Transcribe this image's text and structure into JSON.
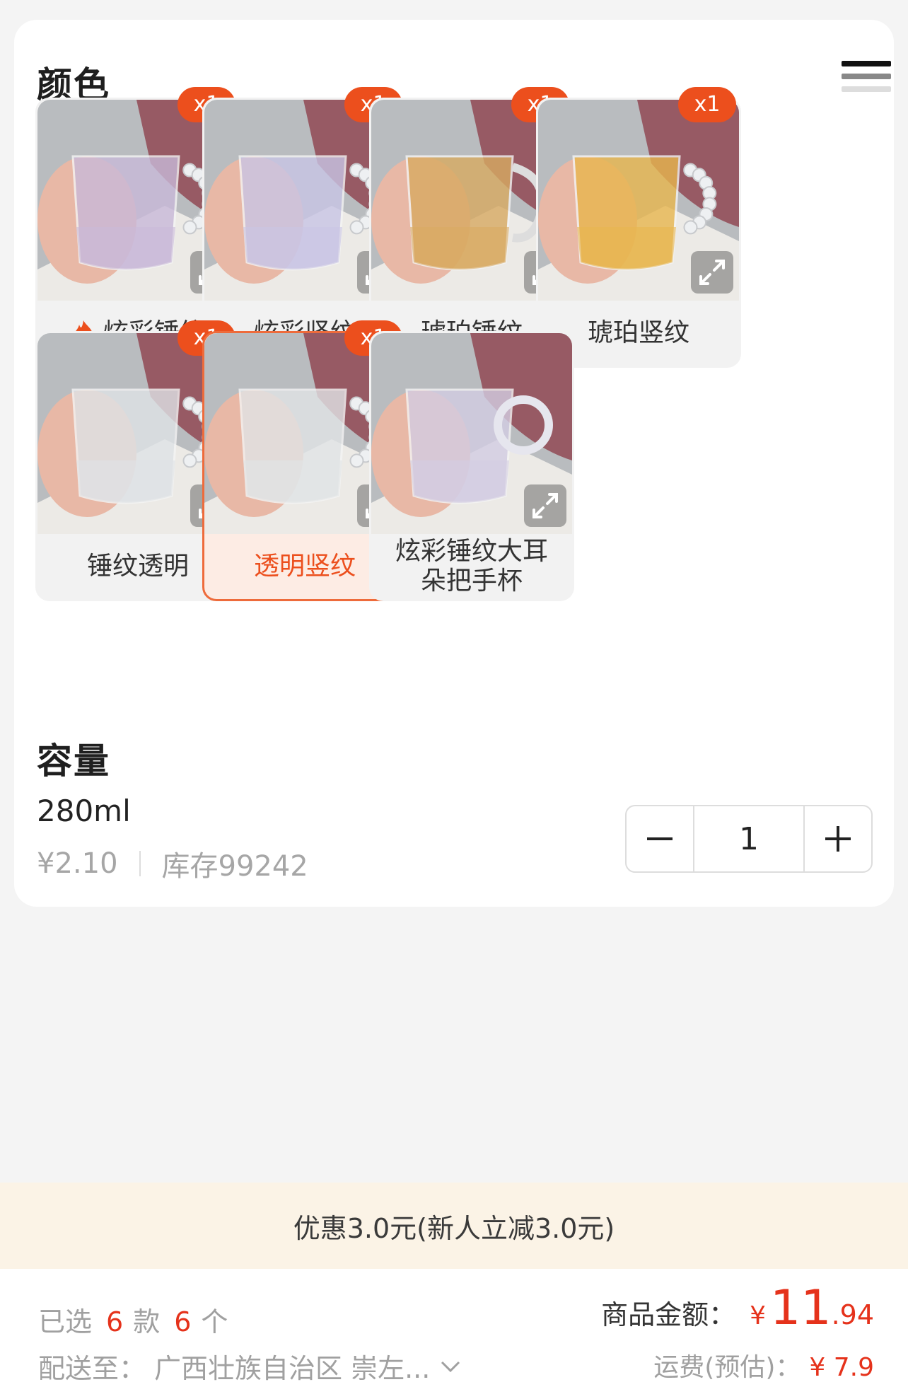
{
  "color_section": {
    "title": "颜色",
    "variants": [
      {
        "label": "炫彩锤纹",
        "badge": "x1",
        "hot": true,
        "selected": false,
        "tint": "#c9b9d9",
        "handle": "beads"
      },
      {
        "label": "炫彩竖纹",
        "badge": "x1",
        "hot": false,
        "selected": false,
        "tint": "#c9c5e5",
        "handle": "beads"
      },
      {
        "label": "琥珀锤纹",
        "badge": "x1",
        "hot": false,
        "selected": false,
        "tint": "#d8aa62",
        "handle": "plain"
      },
      {
        "label": "琥珀竖纹",
        "badge": "x1",
        "hot": false,
        "selected": false,
        "tint": "#e8b64e",
        "handle": "beads"
      },
      {
        "label": "锤纹透明",
        "badge": "x1",
        "hot": false,
        "selected": false,
        "tint": "#dfe3e6",
        "handle": "beads"
      },
      {
        "label": "透明竖纹",
        "badge": "x1",
        "hot": false,
        "selected": true,
        "tint": "#e1e4e6",
        "handle": "beads"
      },
      {
        "label": "炫彩锤纹大耳朵把手杯",
        "badge": "",
        "hot": false,
        "selected": false,
        "tint": "#d3cde3",
        "handle": "ring"
      }
    ]
  },
  "capacity_section": {
    "title": "容量",
    "option": {
      "name": "280ml",
      "price": "¥2.10",
      "stock": "库存99242"
    },
    "quantity": "1"
  },
  "promo": {
    "text": "优惠3.0元(新人立减3.0元)"
  },
  "footer": {
    "selected_prefix": "已选",
    "selected_kinds": "6",
    "kinds_unit": "款",
    "selected_count": "6",
    "count_unit": "个",
    "ship_label": "配送至：",
    "ship_address": "广西壮族自治区 崇左...",
    "amount_label": "商品金额：",
    "amount_currency": "¥",
    "amount_int": "11",
    "amount_dec": ".94",
    "freight_label": "运费(预估)：",
    "freight_value": "¥ 7.9"
  },
  "colors": {
    "accent": "#ec4f1d",
    "price_red": "#e5321b",
    "selected_bg": "#fdece4"
  }
}
